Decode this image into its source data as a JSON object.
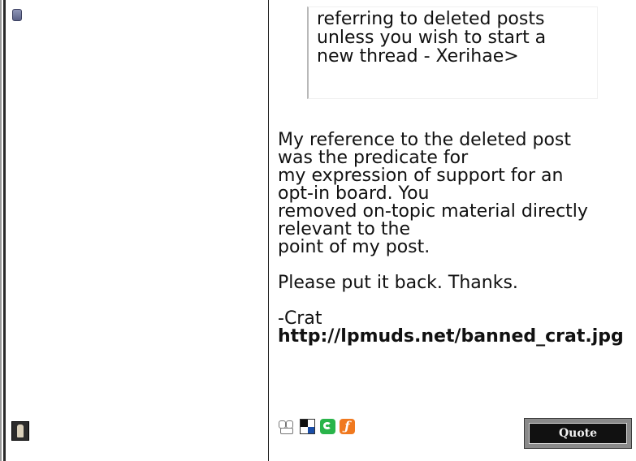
{
  "quote": {
    "text": "referring to deleted posts\nunless you wish to start a\nnew thread - Xerihae>"
  },
  "post": {
    "lines": [
      "My reference to the deleted post",
      "was the predicate for",
      "my expression of support for an",
      "opt-in board. You",
      "removed on-topic material directly",
      "relevant to the",
      "point of my post."
    ],
    "thanks": "Please put it back. Thanks.",
    "signature_name": "-Crat",
    "signature_link": "http://lpmuds.net/banned_crat.jpg"
  },
  "actions": {
    "quote_button_label": "Quote",
    "icons": [
      "profile-icon",
      "msn-icon",
      "chat-icon",
      "flash-icon"
    ]
  },
  "colors": {
    "divider": "#1e1e1e",
    "quote_border": "#b8b8b8",
    "chat_icon": "#29b44a",
    "flash_icon": "#f0791f"
  }
}
